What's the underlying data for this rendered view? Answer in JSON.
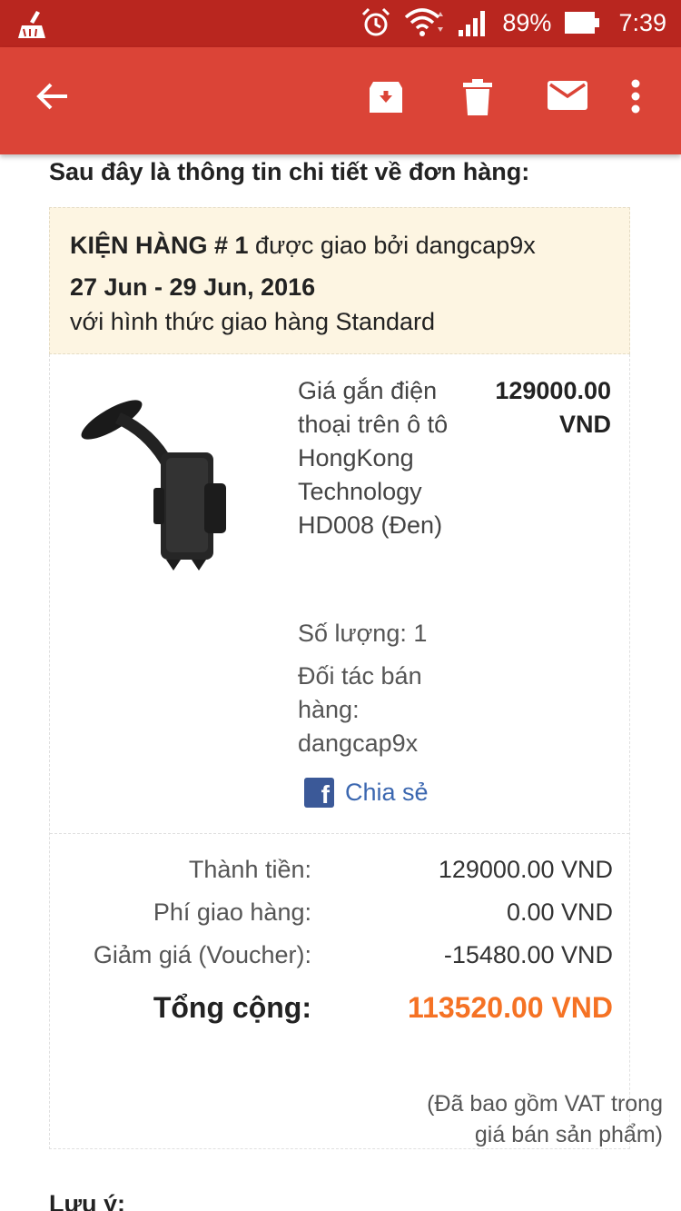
{
  "status_bar": {
    "battery_percent": "89%",
    "time": "7:39",
    "icons": [
      "cleaner-app-icon",
      "alarm-icon",
      "wifi-icon",
      "signal-icon",
      "battery-icon"
    ]
  },
  "app_bar": {
    "icons": [
      "back-arrow-icon",
      "archive-icon",
      "delete-icon",
      "mark-unread-icon",
      "more-vert-icon"
    ]
  },
  "email": {
    "intro": "Sau đây là thông tin chi tiết về đơn hàng:",
    "package": {
      "label": "KIỆN HÀNG # 1",
      "delivered_by": " được giao bởi dangcap9x",
      "date_range": "27 Jun - 29 Jun, 2016",
      "shipping_method": "với hình thức giao hàng Standard"
    },
    "item": {
      "name": "Giá gắn điện thoại trên ô tô HongKong Technology HD008 (Đen)",
      "price": "129000.00 VND",
      "quantity": "Số lượng: 1",
      "seller": "Đối tác bán hàng: dangcap9x",
      "share_label": "Chia sẻ"
    },
    "summary": {
      "subtotal_label": "Thành tiền:",
      "subtotal_value": "129000.00 VND",
      "shipping_label": "Phí giao hàng:",
      "shipping_value": "0.00 VND",
      "discount_label": "Giảm giá (Voucher):",
      "discount_value": "-15480.00 VND",
      "total_label": "Tổng cộng:",
      "total_value": "113520.00 VND",
      "vat_note": "(Đã bao gồm VAT trong giá bán sản phẩm)"
    },
    "note_heading": "Lưu ý:"
  },
  "colors": {
    "status_bar": "#b9261f",
    "app_bar": "#db4437",
    "package_header_bg": "#fdf5e2",
    "total_accent": "#f57224",
    "link": "#3b67b0"
  }
}
